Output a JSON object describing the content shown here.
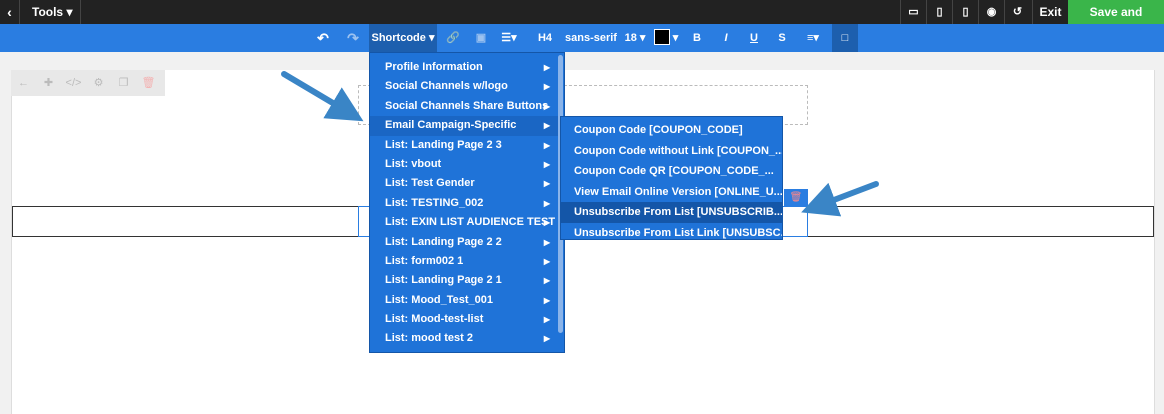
{
  "topbar": {
    "back_glyph": "‹",
    "tools_label": "Tools ▾",
    "icons": [
      "desktop-icon",
      "tablet-icon",
      "mobile-icon",
      "eye-icon",
      "history-icon"
    ],
    "icon_glyphs": [
      "▭",
      "▯",
      "▯",
      "◉",
      "↺"
    ],
    "exit_label": "Exit",
    "save_label": "Save and Update"
  },
  "toolbar": {
    "undo_glyph": "↶",
    "redo_glyph": "↷",
    "shortcode_label": "Shortcode ▾",
    "link_glyph": "🔗",
    "image_glyph": "▣",
    "list_glyph": "☰▾",
    "heading": "H4",
    "font": "sans-serif",
    "size": "18 ▾",
    "color_caret": "▾",
    "bold": "B",
    "italic": "I",
    "underline": "U",
    "strike": "S",
    "align_glyph": "≡▾",
    "box_glyph": "□"
  },
  "mini_toolbar": [
    "←",
    "✚",
    "</>",
    "⚙",
    "❐",
    "🗑"
  ],
  "shortcode_menu": {
    "items": [
      "Profile Information",
      "Social Channels w/logo",
      "Social Channels Share Buttons",
      "Email Campaign-Specific",
      "List: Landing Page 2 3",
      "List: vbout",
      "List: Test Gender",
      "List: TESTING_002",
      "List: EXIN LIST AUDIENCE TEST",
      "List: Landing Page 2 2",
      "List: form002 1",
      "List: Landing Page 2 1",
      "List: Mood_Test_001",
      "List: Mood-test-list",
      "List: mood test 2"
    ],
    "arrow": "▶"
  },
  "submenu": {
    "items": [
      "Coupon Code [COUPON_CODE]",
      "Coupon Code without Link [COUPON_...",
      "Coupon Code QR [COUPON_CODE_...",
      "View Email Online Version [ONLINE_U...",
      "Unsubscribe From List [UNSUBSCRIB...",
      "Unsubscribe From List Link [UNSUBSC..."
    ]
  },
  "colors": {
    "toolbar_blue": "#2a7de1",
    "menu_blue": "#1f73d8",
    "save_green": "#3ab54a",
    "topbar_dark": "#222222",
    "arrow_blue": "#3a85c6"
  }
}
